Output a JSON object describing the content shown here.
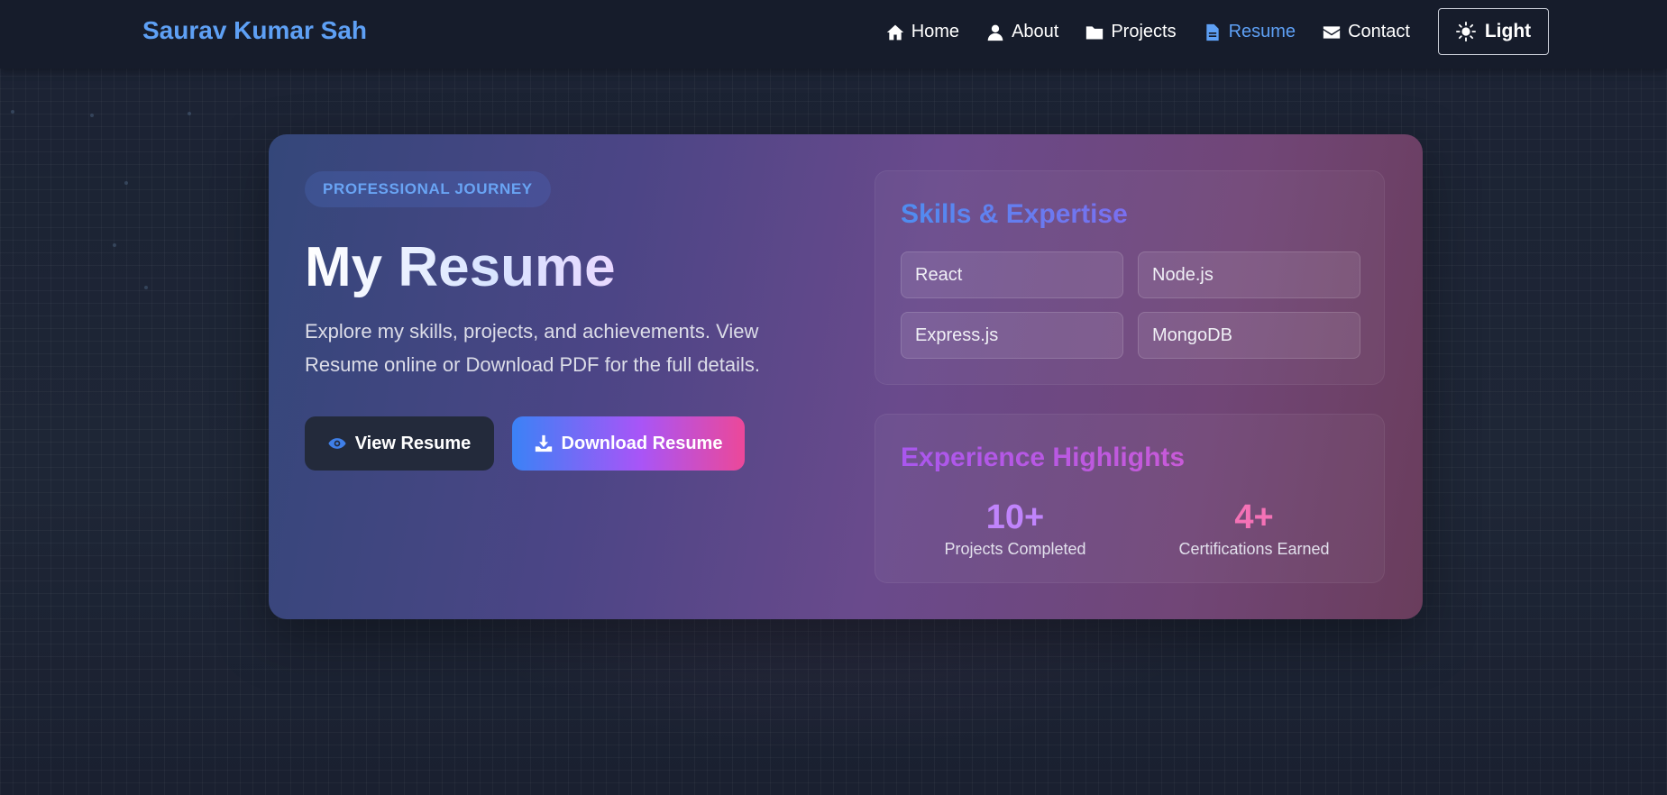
{
  "nav": {
    "brand": "Saurav Kumar Sah",
    "links": [
      {
        "label": "Home",
        "icon": "home-icon"
      },
      {
        "label": "About",
        "icon": "user-icon"
      },
      {
        "label": "Projects",
        "icon": "folder-icon"
      },
      {
        "label": "Resume",
        "icon": "document-icon",
        "active": true
      },
      {
        "label": "Contact",
        "icon": "envelope-icon"
      }
    ],
    "theme_label": "Light",
    "theme_icon": "sun-icon"
  },
  "hero": {
    "badge": "PROFESSIONAL JOURNEY",
    "title": "My Resume",
    "description": "Explore my skills, projects, and achievements. View Resume online or Download PDF for the full details.",
    "view_button": "View Resume",
    "view_icon": "eye-icon",
    "download_button": "Download Resume",
    "download_icon": "download-icon"
  },
  "skills": {
    "title": "Skills & Expertise",
    "items": [
      "React",
      "Node.js",
      "Express.js",
      "MongoDB"
    ]
  },
  "experience": {
    "title": "Experience Highlights",
    "stats": [
      {
        "value": "10+",
        "label": "Projects Completed"
      },
      {
        "value": "4+",
        "label": "Certifications Earned"
      }
    ]
  },
  "colors": {
    "accent_blue": "#5ea0f5",
    "accent_purple": "#c084fc",
    "accent_pink": "#f472b6",
    "navbar_bg": "#161c2b",
    "page_bg": "#1a2030"
  }
}
